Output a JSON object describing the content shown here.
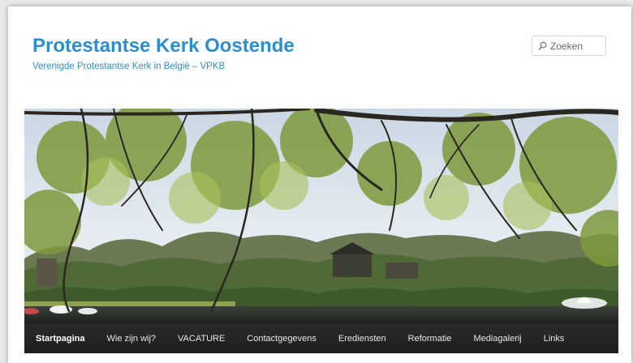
{
  "site": {
    "title": "Protestantse Kerk Oostende",
    "description": "Verenigde Protestantse Kerk in België – VPKB"
  },
  "search": {
    "placeholder": "Zoeken",
    "icon": "search-icon"
  },
  "header_image": {
    "description_icon": "park-pond-photo"
  },
  "nav": {
    "items": [
      {
        "label": "Startpagina",
        "active": true
      },
      {
        "label": "Wie zijn wij?"
      },
      {
        "label": "VACATURE"
      },
      {
        "label": "Contactgegevens"
      },
      {
        "label": "Erediensten"
      },
      {
        "label": "Reformatie"
      },
      {
        "label": "Mediagalerij"
      },
      {
        "label": "Links"
      }
    ]
  },
  "colors": {
    "brand": "#2a8fcf",
    "navbar": "#222222"
  }
}
